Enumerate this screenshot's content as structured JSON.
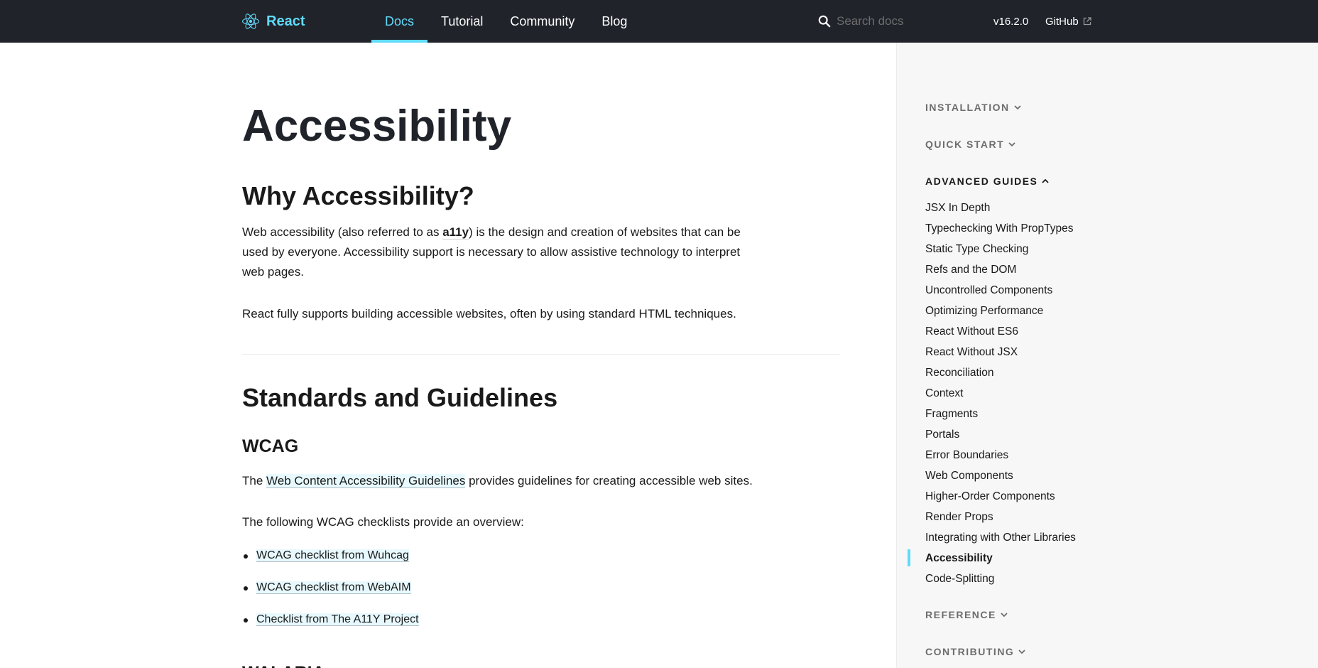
{
  "topbar": {
    "brand": "React",
    "nav": [
      "Docs",
      "Tutorial",
      "Community",
      "Blog"
    ],
    "active_nav": "Docs",
    "search_placeholder": "Search docs",
    "version": "v16.2.0",
    "github": "GitHub",
    "accent_color": "#61dafb",
    "background_color": "#20232a",
    "icons": {
      "logo": "react-atom-logo-icon",
      "search": "search-icon",
      "external": "external-link-icon"
    }
  },
  "content": {
    "title": "Accessibility",
    "why": {
      "heading": "Why Accessibility?",
      "p1_before": "Web accessibility (also referred to as ",
      "p1_strong": "a11y",
      "p1_after": ") is the design and creation of websites that can be used by everyone. Accessibility support is necessary to allow assistive technology to interpret web pages.",
      "p2": "React fully supports building accessible websites, often by using standard HTML techniques."
    },
    "standards": {
      "heading": "Standards and Guidelines",
      "wcag_heading": "WCAG",
      "wcag_p_before": "The ",
      "wcag_p_link": "Web Content Accessibility Guidelines",
      "wcag_p_after": " provides guidelines for creating accessible web sites.",
      "checklist_intro": "The following WCAG checklists provide an overview:",
      "checklists": [
        "WCAG checklist from Wuhcag",
        "WCAG checklist from WebAIM",
        "Checklist from The A11Y Project"
      ],
      "next_heading_partial": "WAI-ARIA"
    }
  },
  "sidebar": {
    "sections": {
      "installation": "INSTALLATION",
      "quick_start": "QUICK START",
      "advanced_guides": "ADVANCED GUIDES",
      "reference": "REFERENCE",
      "contributing": "CONTRIBUTING"
    },
    "advanced_items": [
      "JSX In Depth",
      "Typechecking With PropTypes",
      "Static Type Checking",
      "Refs and the DOM",
      "Uncontrolled Components",
      "Optimizing Performance",
      "React Without ES6",
      "React Without JSX",
      "Reconciliation",
      "Context",
      "Fragments",
      "Portals",
      "Error Boundaries",
      "Web Components",
      "Higher-Order Components",
      "Render Props",
      "Integrating with Other Libraries",
      "Accessibility",
      "Code-Splitting"
    ],
    "active_item": "Accessibility"
  }
}
